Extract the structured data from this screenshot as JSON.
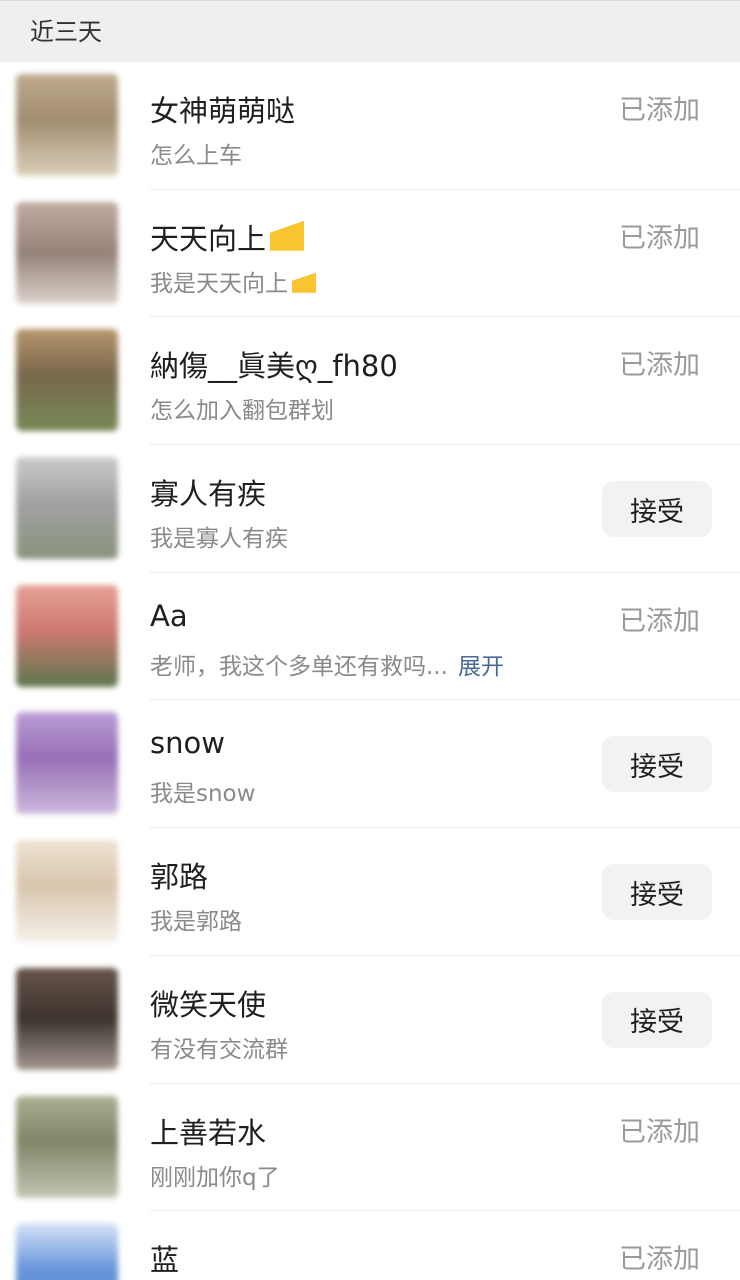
{
  "header": {
    "title": "近三天"
  },
  "rows": [
    {
      "name": "女神萌萌哒",
      "message": "怎么上车",
      "status": "已添加",
      "avatar_color": "#b59f86"
    },
    {
      "name": "天天向上",
      "message": "我是天天向上",
      "status": "已添加",
      "avatar_color": "#a18f84"
    },
    {
      "name": "納傷__眞美ღ_fh80",
      "message": "怎么加入翻包群划",
      "status": "已添加",
      "avatar_color": "#8a7456"
    },
    {
      "name": "寡人有疾",
      "message": "我是寡人有疾",
      "action": "接受",
      "avatar_color": "#9b9b9b"
    },
    {
      "name": "Aa",
      "message": "老师，我这个多单还有救吗...",
      "expand": "展开",
      "status": "已添加",
      "avatar_color": "#d87f76"
    },
    {
      "name": "snow",
      "message": "我是snow",
      "action": "接受",
      "avatar_color": "#a27fbe"
    },
    {
      "name": "郭路",
      "message": "我是郭路",
      "action": "接受",
      "avatar_color": "#ddc7ad"
    },
    {
      "name": "微笑天使",
      "message": "有没有交流群",
      "action": "接受",
      "avatar_color": "#4e3a30"
    },
    {
      "name": "上善若水",
      "message": "刚刚加你q了",
      "status": "已添加",
      "avatar_color": "#8a8d6d"
    },
    {
      "name": "蓝",
      "message": "",
      "status": "已添加",
      "avatar_color": "#5d8ed6"
    }
  ]
}
